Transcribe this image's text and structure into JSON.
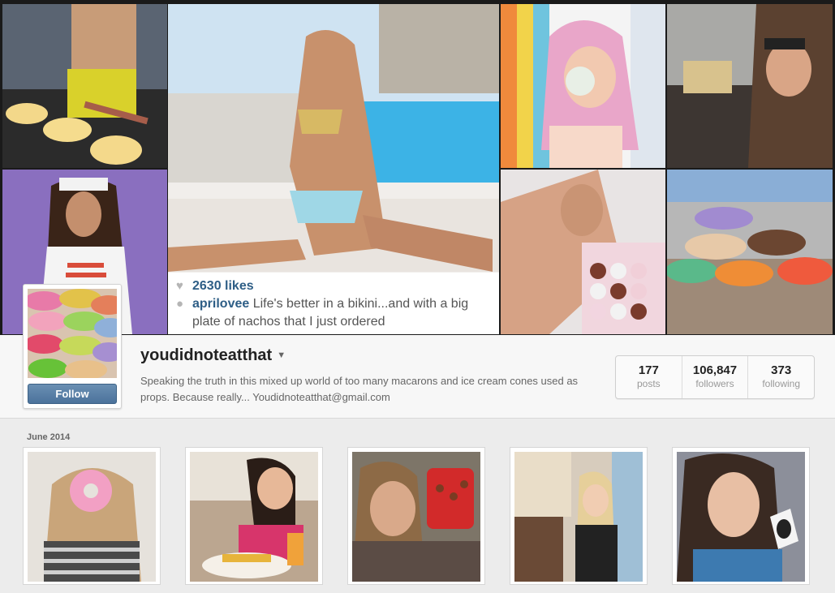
{
  "featured_post": {
    "likes": "2630 likes",
    "caption_user": "aprilovee",
    "caption_text": "Life's better in a bikini...and with a big plate of nachos that I just ordered"
  },
  "profile": {
    "username": "youdidnoteatthat",
    "bio": "Speaking the truth in this mixed up world of too many macarons and ice cream cones used as props. Because really... Youdidnoteatthat@gmail.com",
    "follow_label": "Follow",
    "stats": [
      {
        "value": "177",
        "label": "posts"
      },
      {
        "value": "106,847",
        "label": "followers"
      },
      {
        "value": "373",
        "label": "following"
      }
    ]
  },
  "month": {
    "label": "June 2014"
  },
  "icons": {
    "like": "heart-icon",
    "comment": "comment-icon",
    "dropdown": "caret-down-icon"
  },
  "colors": {
    "link_blue": "#2e5e86",
    "follow_button": "#4b729b"
  }
}
